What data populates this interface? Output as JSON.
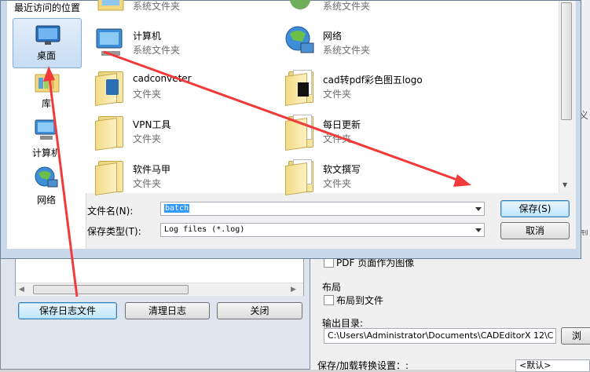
{
  "sidebar": {
    "header": "最近访问的位置",
    "items": [
      {
        "label": "桌面",
        "icon": "desktop-icon"
      },
      {
        "label": "库",
        "icon": "library-icon"
      },
      {
        "label": "计算机",
        "icon": "computer-icon"
      },
      {
        "label": "网络",
        "icon": "network-icon"
      }
    ]
  },
  "files": [
    {
      "name": "",
      "type": "系统文件夹",
      "icon": "library-folder-icon"
    },
    {
      "name": "",
      "type": "系统文件夹",
      "icon": "user-folder-icon"
    },
    {
      "name": "计算机",
      "type": "系统文件夹",
      "icon": "computer-icon"
    },
    {
      "name": "网络",
      "type": "系统文件夹",
      "icon": "network-icon"
    },
    {
      "name": "cadconveter",
      "type": "文件夹",
      "icon": "folder-icon"
    },
    {
      "name": "cad转pdf彩色图五logo",
      "type": "文件夹",
      "icon": "folder-icon"
    },
    {
      "name": "VPN工具",
      "type": "文件夹",
      "icon": "folder-icon"
    },
    {
      "name": "每日更新",
      "type": "文件夹",
      "icon": "folder-icon"
    },
    {
      "name": "软件马甲",
      "type": "文件夹",
      "icon": "folder-icon"
    },
    {
      "name": "软文撰写",
      "type": "文件夹",
      "icon": "folder-icon"
    }
  ],
  "form": {
    "filename_label": "文件名(N):",
    "filename_value": "batch",
    "filetype_label": "保存类型(T):",
    "filetype_value": "Log files (*.log)",
    "save_button": "保存(S)",
    "cancel_button": "取消"
  },
  "log_dialog": {
    "save_log_button": "保存日志文件",
    "clear_log_button": "清理日志",
    "close_button": "关闭"
  },
  "bg_app": {
    "pdf_option": "PDF 页面作为图像",
    "layout_header": "布局",
    "layout_to_file": "布局到文件",
    "output_dir_label": "输出目录:",
    "output_dir_value": "C:\\Users\\Administrator\\Documents\\CADEditorX 12\\C",
    "browse_button": "浏",
    "settings_label": "保存/加载转换设置：:",
    "default_option": "<默认>",
    "partial_right_1": "义",
    "partial_right_2": "型"
  },
  "colors": {
    "annotation_arrow": "#f23a3a",
    "selection": "#3399ff"
  }
}
